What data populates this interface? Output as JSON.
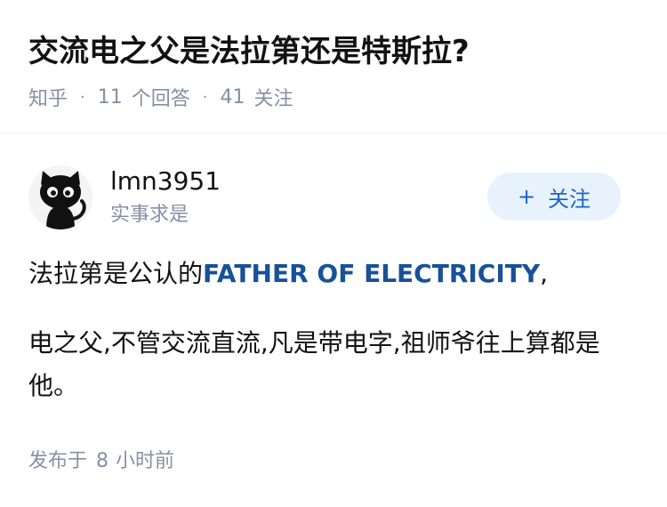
{
  "question": {
    "title": "交流电之父是法拉第还是特斯拉?",
    "source": "知乎",
    "answer_count": "11",
    "answer_label": "个回答",
    "follower_count": "41",
    "follower_label": "关注"
  },
  "author": {
    "name": "lmn3951",
    "bio": "实事求是",
    "avatar_icon": "black-cat-avatar",
    "follow_plus": "+",
    "follow_label": "关注"
  },
  "answer": {
    "p1_prefix": "法拉第是公认的",
    "p1_link": "FATHER OF ELECTRICITY",
    "p1_suffix": ",",
    "p2": "电之父,不管交流直流,凡是带电字,祖师爷往上算都是他。"
  },
  "post_time": {
    "prefix": "发布于",
    "number": "8",
    "unit": "小时前"
  },
  "colors": {
    "accent": "#1a66c8",
    "link": "#175199",
    "meta": "#8590a6",
    "follow_bg": "#e8f2fc"
  }
}
